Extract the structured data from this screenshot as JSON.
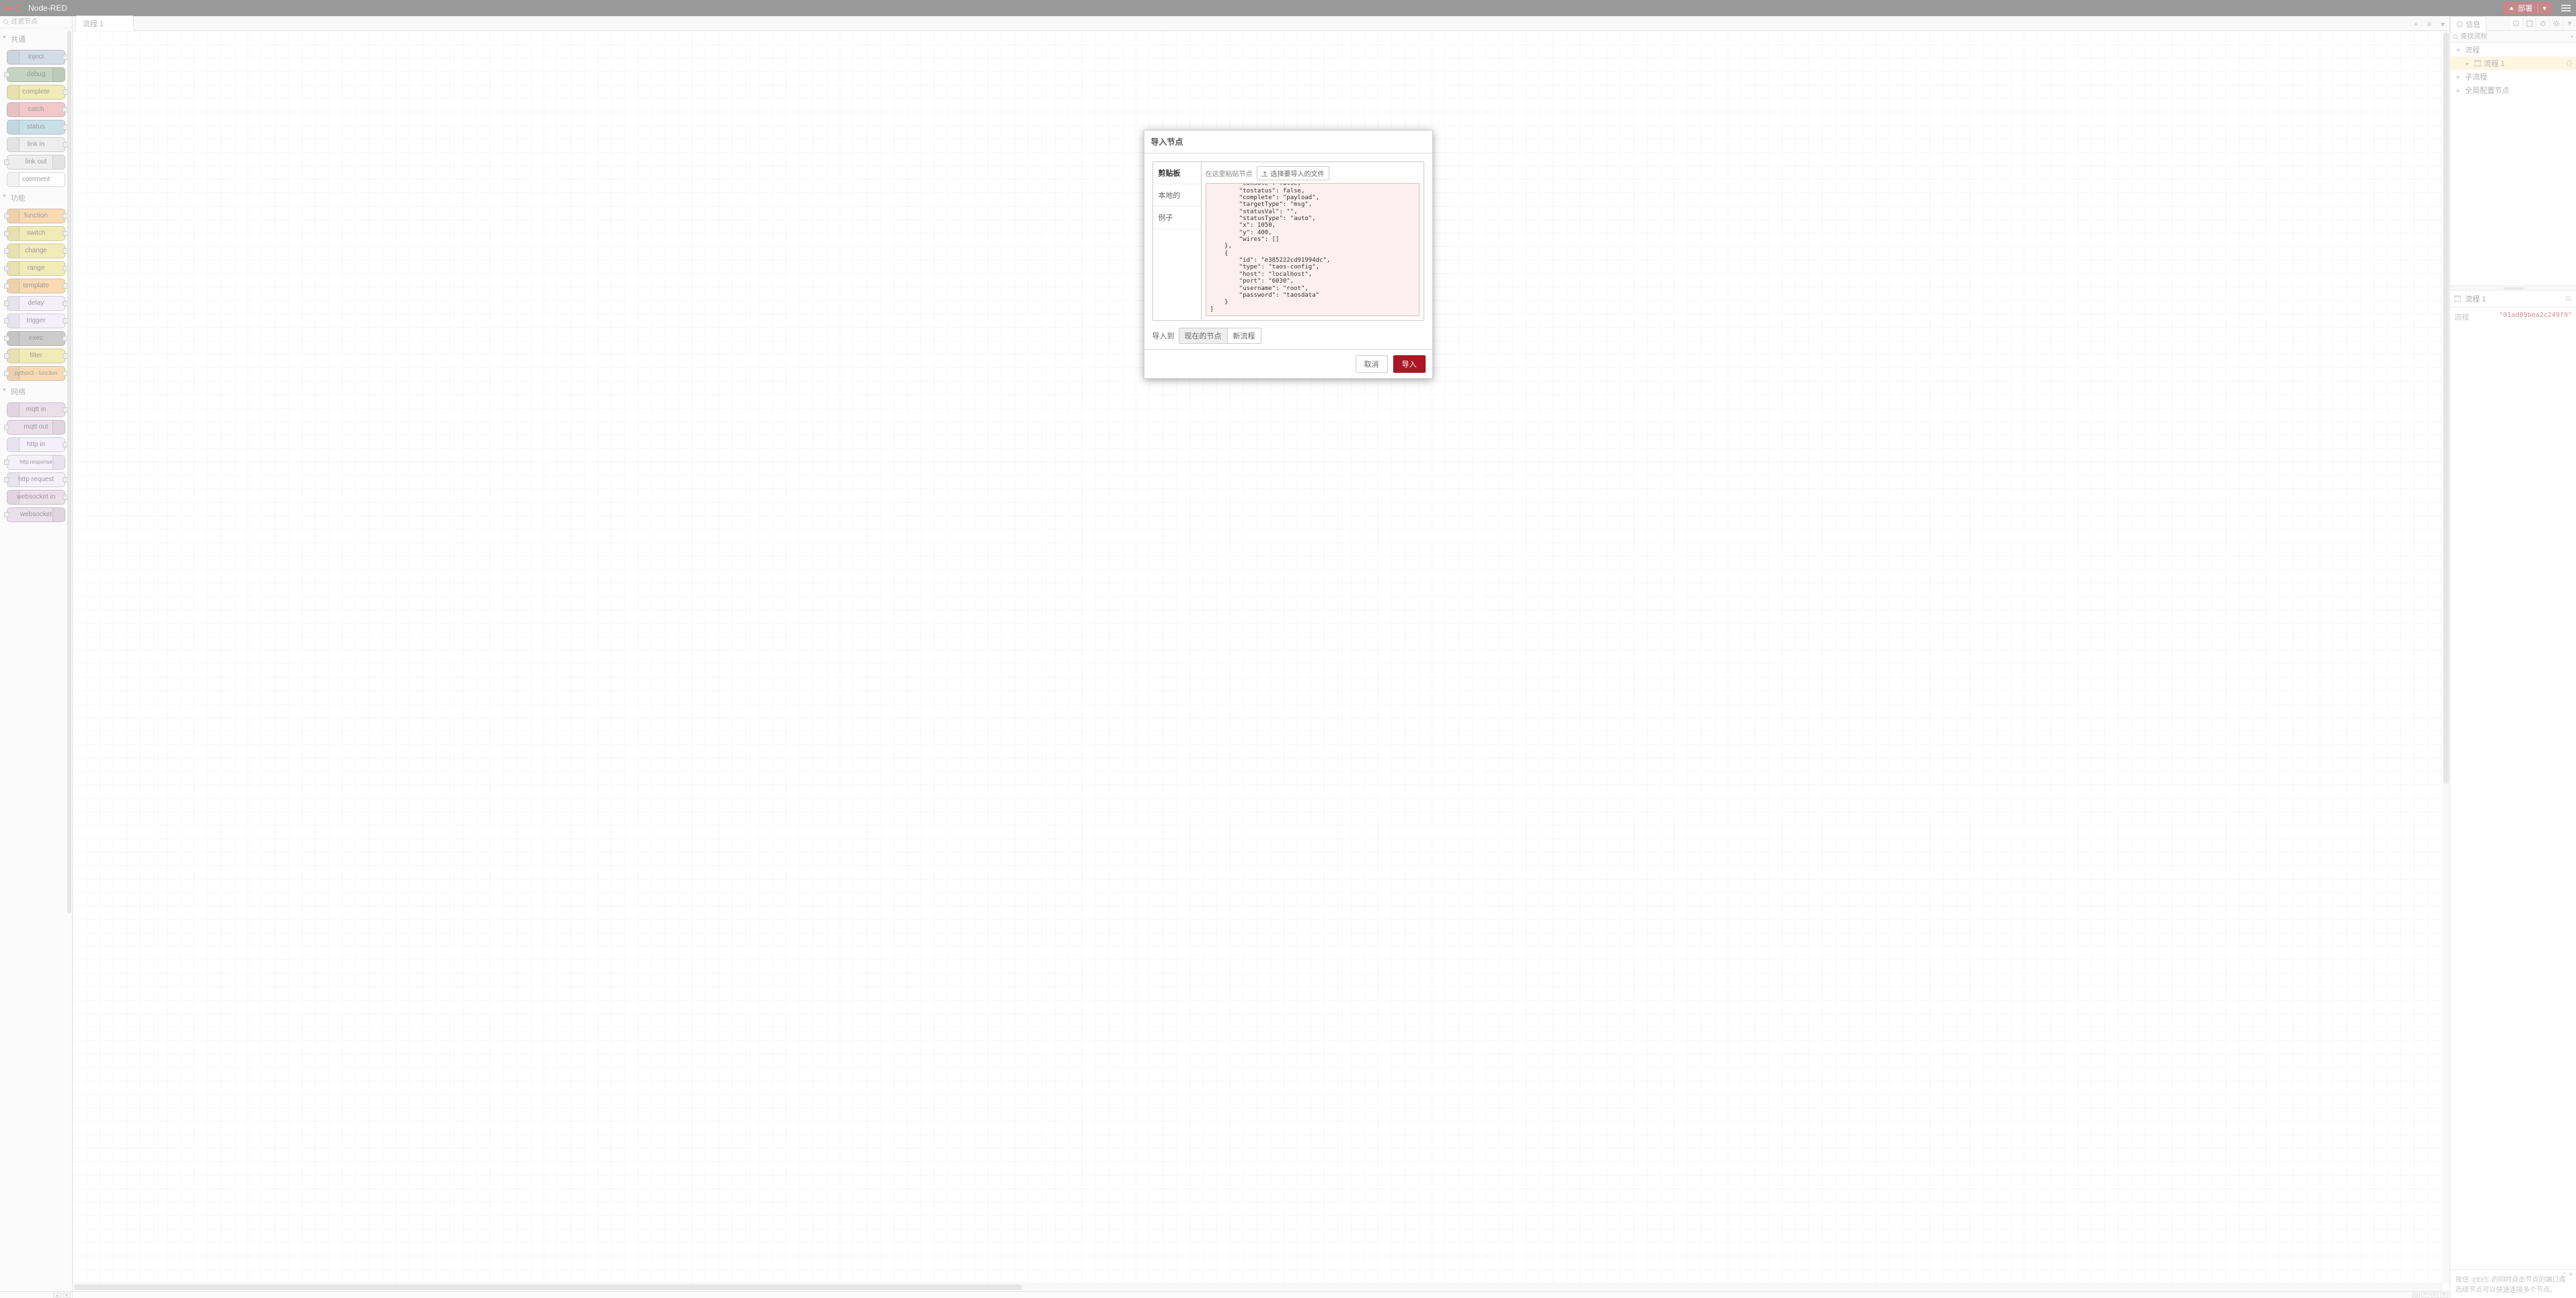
{
  "header": {
    "title": "Node-RED",
    "deploy_label": "部署"
  },
  "palette": {
    "search_placeholder": "过滤节点",
    "categories": [
      {
        "label": "共通",
        "nodes": [
          {
            "label": "inject",
            "cls": "c-inject",
            "in": false,
            "out": true,
            "right": false
          },
          {
            "label": "debug",
            "cls": "c-debug",
            "in": true,
            "out": false,
            "right": true
          },
          {
            "label": "complete",
            "cls": "c-complete",
            "in": false,
            "out": true,
            "right": false
          },
          {
            "label": "catch",
            "cls": "c-catch",
            "in": false,
            "out": true,
            "right": false
          },
          {
            "label": "status",
            "cls": "c-status",
            "in": false,
            "out": true,
            "right": false
          },
          {
            "label": "link in",
            "cls": "c-link",
            "in": false,
            "out": true,
            "right": false
          },
          {
            "label": "link out",
            "cls": "c-link",
            "in": true,
            "out": false,
            "right": true
          },
          {
            "label": "comment",
            "cls": "c-comment",
            "in": false,
            "out": false,
            "right": false
          }
        ]
      },
      {
        "label": "功能",
        "nodes": [
          {
            "label": "function",
            "cls": "c-function",
            "in": true,
            "out": true,
            "right": false
          },
          {
            "label": "switch",
            "cls": "c-switch",
            "in": true,
            "out": true,
            "right": false
          },
          {
            "label": "change",
            "cls": "c-change",
            "in": true,
            "out": true,
            "right": false
          },
          {
            "label": "range",
            "cls": "c-range",
            "in": true,
            "out": true,
            "right": false
          },
          {
            "label": "template",
            "cls": "c-template",
            "in": true,
            "out": true,
            "right": false
          },
          {
            "label": "delay",
            "cls": "c-delay",
            "in": true,
            "out": true,
            "right": false
          },
          {
            "label": "trigger",
            "cls": "c-trigger",
            "in": true,
            "out": true,
            "right": false
          },
          {
            "label": "exec",
            "cls": "c-exec",
            "in": true,
            "out": true,
            "right": false
          },
          {
            "label": "filter",
            "cls": "c-filter",
            "in": true,
            "out": true,
            "right": false
          },
          {
            "label": "python3 - function",
            "cls": "c-python",
            "in": true,
            "out": true,
            "right": false
          }
        ]
      },
      {
        "label": "网络",
        "nodes": [
          {
            "label": "mqtt in",
            "cls": "c-mqtt",
            "in": false,
            "out": true,
            "right": false
          },
          {
            "label": "mqtt out",
            "cls": "c-mqtt",
            "in": true,
            "out": false,
            "right": true
          },
          {
            "label": "http in",
            "cls": "c-http",
            "in": false,
            "out": true,
            "right": false
          },
          {
            "label": "http response",
            "cls": "c-http",
            "in": true,
            "out": false,
            "right": true
          },
          {
            "label": "http request",
            "cls": "c-http",
            "in": true,
            "out": true,
            "right": false
          },
          {
            "label": "websocket in",
            "cls": "c-ws",
            "in": false,
            "out": true,
            "right": false
          },
          {
            "label": "websocket",
            "cls": "c-ws",
            "in": true,
            "out": false,
            "right": true
          }
        ]
      }
    ]
  },
  "workspace": {
    "tab_label": "流程 1"
  },
  "sidebar": {
    "tab_label": "信息",
    "search_placeholder": "查找流程",
    "outline": {
      "flows_label": "流程",
      "flow1_label": "流程 1",
      "subflows_label": "子流程",
      "config_label": "全局配置节点"
    },
    "info_panel": {
      "title": "流程 1",
      "prop_key": "流程",
      "prop_val": "\"01ad89bea2c249f9\""
    },
    "tip_text_1": "按住 ",
    "tip_code": "ctrl",
    "tip_text_2": " 的同时点击节点的端口或后续节点可以快速连接多个节点。"
  },
  "dialog": {
    "title": "导入节点",
    "tabs": {
      "clipboard": "剪贴板",
      "local": "本地的",
      "examples": "例子"
    },
    "paste_hint": "在这里粘贴节点",
    "select_file": "选择要导入的文件",
    "json_content": "        \"tosidebar\": true,\n        \"console\": false,\n        \"tostatus\": false,\n        \"complete\": \"payload\",\n        \"targetType\": \"msg\",\n        \"statusVal\": \"\",\n        \"statusType\": \"auto\",\n        \"x\": 1050,\n        \"y\": 400,\n        \"wires\": []\n    },\n    {\n        \"id\": \"e385222cd91994dc\",\n        \"type\": \"taos-config\",\n        \"host\": \"localhost\",\n        \"port\": \"6030\",\n        \"username\": \"root\",\n        \"password\": \"taosdata\"\n    }\n]",
    "import_to_label": "导入到",
    "dest_current": "现在的节点",
    "dest_new": "新流程",
    "cancel": "取消",
    "import": "导入"
  }
}
